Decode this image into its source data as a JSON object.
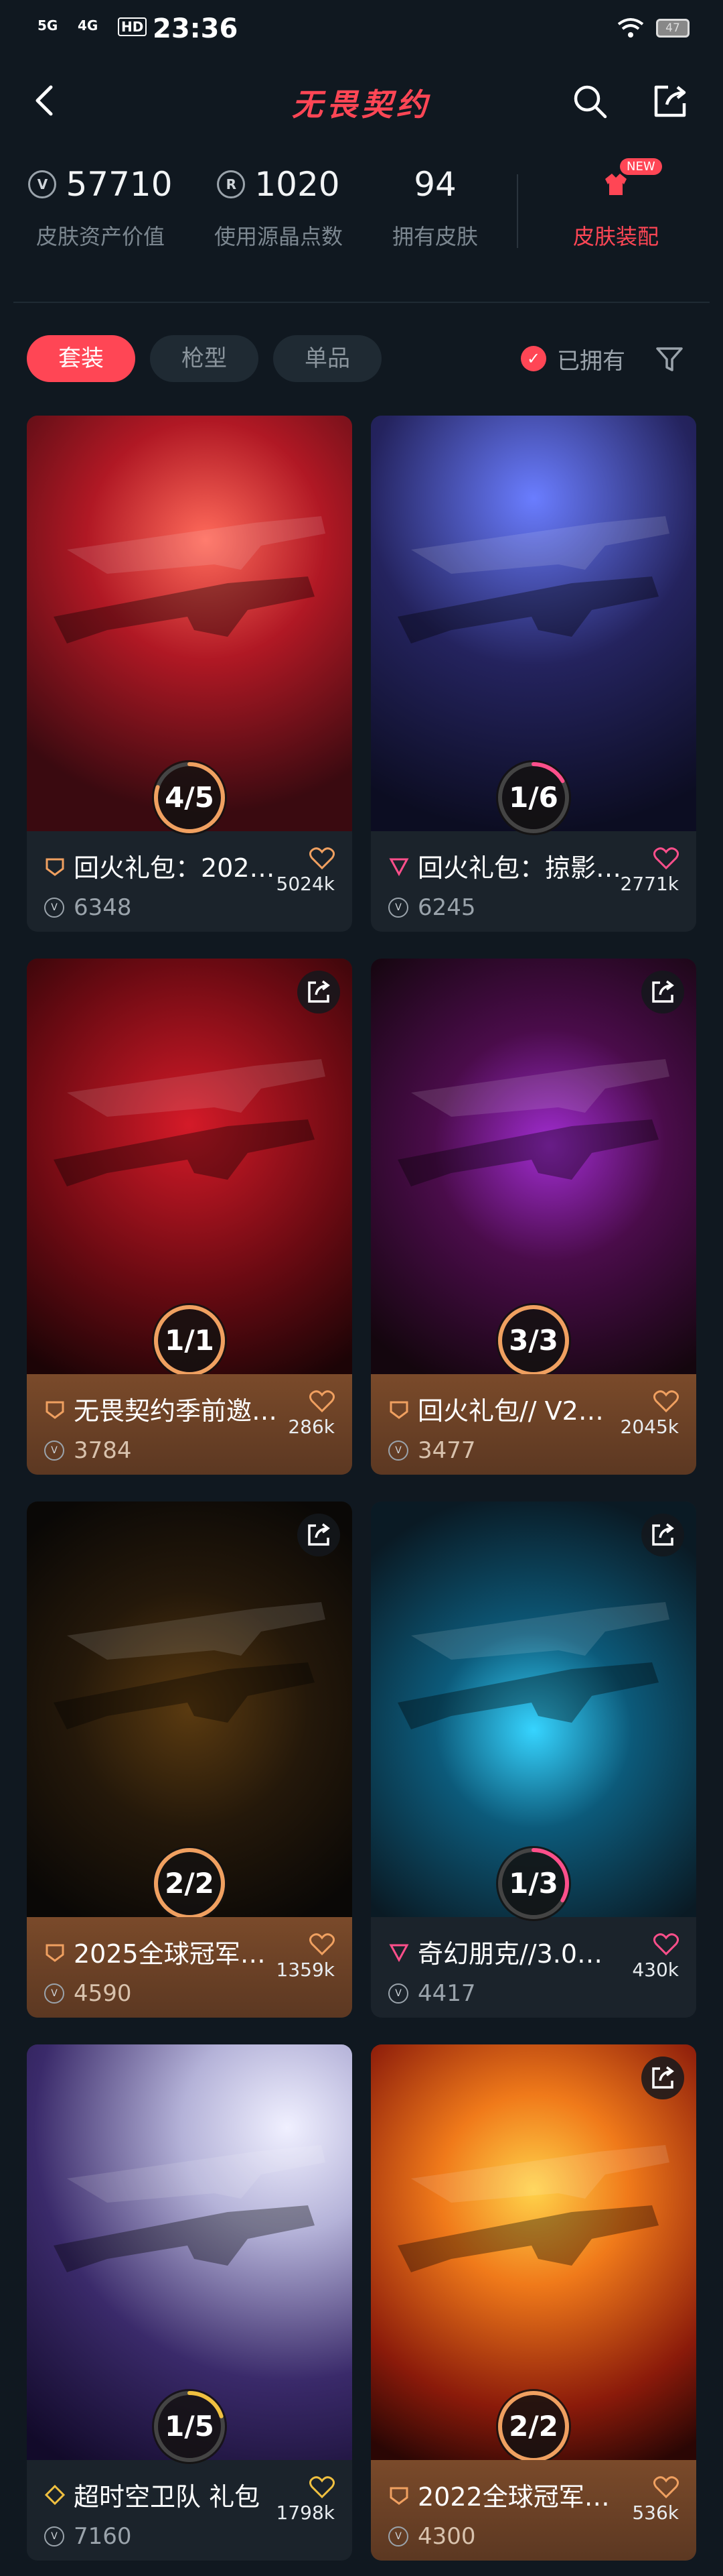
{
  "status_bar": {
    "signal1": "5G",
    "signal2": "4G",
    "hd": "HD",
    "time": "23:36",
    "battery": "47"
  },
  "header": {
    "title": "无畏契约"
  },
  "stats": [
    {
      "value": "57710",
      "label": "皮肤资产价值",
      "icon": "V"
    },
    {
      "value": "1020",
      "label": "使用源晶点数",
      "icon": "R"
    },
    {
      "value": "94",
      "label": "拥有皮肤",
      "icon": ""
    }
  ],
  "outfit": {
    "label": "皮肤装配",
    "badge": "NEW"
  },
  "filters": {
    "tabs": [
      "套装",
      "枪型",
      "单品"
    ],
    "owned_label": "已拥有"
  },
  "colors": {
    "accent": "#ff4655",
    "gold": "#f0a060"
  },
  "cards": [
    {
      "name": "回火礼包：202…",
      "price": "6348",
      "likes": "5024k",
      "progress": "4/5",
      "ratio": 0.8,
      "ring": "#f0a060",
      "tier": "gold-tier-icon",
      "gold": false,
      "art": "bg-red"
    },
    {
      "name": "回火礼包：掠影…",
      "price": "6245",
      "likes": "2771k",
      "progress": "1/6",
      "ratio": 0.167,
      "ring": "#ff4f8b",
      "tier": "pink-tier-icon",
      "gold": false,
      "art": "bg-blue"
    },
    {
      "name": "无畏契约季前邀…",
      "price": "3784",
      "likes": "286k",
      "progress": "1/1",
      "ratio": 1,
      "ring": "#f0a060",
      "tier": "gold-tier-icon",
      "gold": true,
      "art": "bg-crimson"
    },
    {
      "name": "回火礼包// V2…",
      "price": "3477",
      "likes": "2045k",
      "progress": "3/3",
      "ratio": 1,
      "ring": "#f0a060",
      "tier": "gold-tier-icon",
      "gold": true,
      "art": "bg-purple"
    },
    {
      "name": "2025全球冠军…",
      "price": "4590",
      "likes": "1359k",
      "progress": "2/2",
      "ratio": 1,
      "ring": "#f0a060",
      "tier": "gold-tier-icon",
      "gold": true,
      "art": "bg-dark-gold"
    },
    {
      "name": "奇幻朋克//3.0…",
      "price": "4417",
      "likes": "430k",
      "progress": "1/3",
      "ratio": 0.333,
      "ring": "#ff4f8b",
      "tier": "pink-tier-icon",
      "gold": false,
      "art": "bg-teal"
    },
    {
      "name": "超时空卫队  礼包",
      "price": "7160",
      "likes": "1798k",
      "progress": "1/5",
      "ratio": 0.2,
      "ring": "#f0c040",
      "tier": "yellow-tier-icon",
      "gold": false,
      "art": "bg-space"
    },
    {
      "name": "2022全球冠军…",
      "price": "4300",
      "likes": "536k",
      "progress": "2/2",
      "ratio": 1,
      "ring": "#f0a060",
      "tier": "gold-tier-icon",
      "gold": true,
      "art": "bg-fire"
    }
  ]
}
